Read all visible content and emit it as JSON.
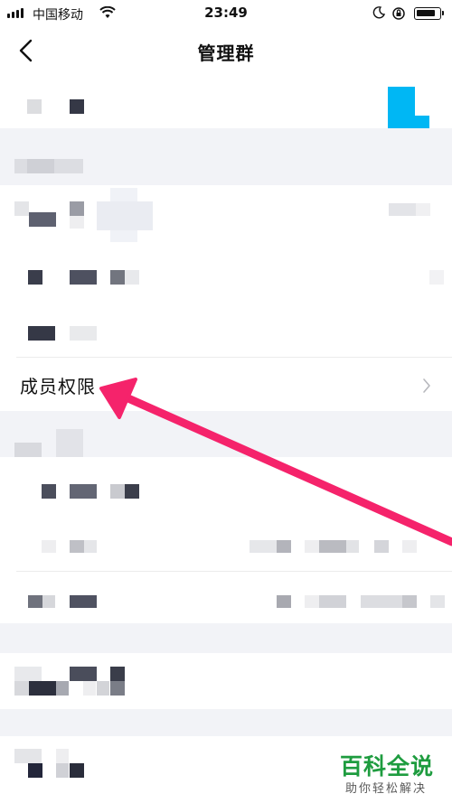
{
  "status_bar": {
    "carrier": "中国移动",
    "time": "23:49",
    "icons": [
      "signal-icon",
      "wifi-icon",
      "moon-icon",
      "rotation-lock-icon",
      "battery-icon"
    ]
  },
  "nav": {
    "title": "管理群",
    "back_icon": "chevron-left-icon"
  },
  "menu": {
    "member_permissions_label": "成员权限",
    "member_permissions_icon": "chevron-right-icon"
  },
  "annotation": {
    "arrow_color": "#f5236b"
  },
  "watermark": {
    "title": "百科全说",
    "subtitle": "助你轻松解决"
  },
  "colors": {
    "background": "#f2f3f7",
    "section": "#ffffff",
    "accent_green": "#1e9c3f"
  }
}
